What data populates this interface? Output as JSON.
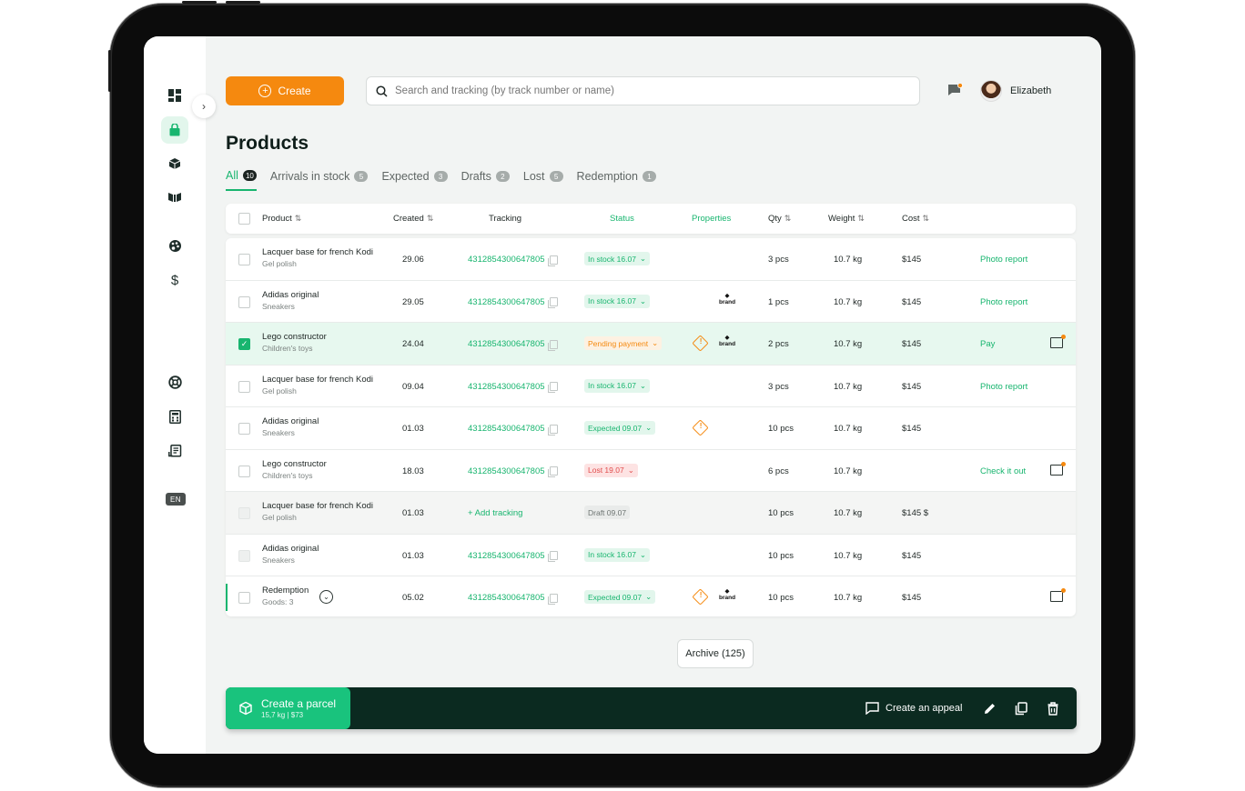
{
  "header": {
    "create_label": "Create",
    "search_placeholder": "Search and tracking (by track number or name)",
    "user_name": "Elizabeth"
  },
  "sidebar": {
    "items": [
      {
        "icon": "dashboard-icon"
      },
      {
        "icon": "shopping-bag-icon",
        "active": true
      },
      {
        "icon": "box-icon"
      },
      {
        "icon": "parcels-icon"
      },
      {
        "icon": "palette-icon"
      },
      {
        "icon": "dollar-icon"
      },
      {
        "icon": "support-icon"
      },
      {
        "icon": "calculator-icon"
      },
      {
        "icon": "documents-icon"
      }
    ],
    "language": "EN"
  },
  "page": {
    "title": "Products",
    "tabs": [
      {
        "label": "All",
        "count": "10",
        "active": true
      },
      {
        "label": "Arrivals in stock",
        "count": "5"
      },
      {
        "label": "Expected",
        "count": "3"
      },
      {
        "label": "Drafts",
        "count": "2"
      },
      {
        "label": "Lost",
        "count": "5"
      },
      {
        "label": "Redemption",
        "count": "1"
      }
    ]
  },
  "table": {
    "columns": {
      "product": "Product",
      "created": "Created",
      "tracking": "Tracking",
      "status": "Status",
      "properties": "Properties",
      "qty": "Qty",
      "weight": "Weight",
      "cost": "Cost"
    },
    "rows": [
      {
        "name": "Lacquer base for french Kodi",
        "sub": "Gel polish",
        "created": "29.06",
        "tracking": "4312854300647805",
        "status": "In stock 16.07",
        "qty": "3 pcs",
        "weight": "10.7 kg",
        "cost": "$145",
        "action": "Photo report"
      },
      {
        "name": "Adidas original",
        "sub": "Sneakers",
        "created": "29.05",
        "tracking": "4312854300647805",
        "status": "In stock 16.07",
        "brand": "brand",
        "qty": "1 pcs",
        "weight": "10.7 kg",
        "cost": "$145",
        "action": "Photo report"
      },
      {
        "name": "Lego constructor",
        "sub": "Children's toys",
        "created": "24.04",
        "tracking": "4312854300647805",
        "status": "Pending payment",
        "brand": "brand",
        "qty": "2 pcs",
        "weight": "10.7 kg",
        "cost": "$145",
        "action": "Pay"
      },
      {
        "name": "Lacquer base for french Kodi",
        "sub": "Gel polish",
        "created": "09.04",
        "tracking": "4312854300647805",
        "status": "In stock 16.07",
        "qty": "3 pcs",
        "weight": "10.7 kg",
        "cost": "$145",
        "action": "Photo report"
      },
      {
        "name": "Adidas original",
        "sub": "Sneakers",
        "created": "01.03",
        "tracking": "4312854300647805",
        "status": "Expected 09.07",
        "qty": "10 pcs",
        "weight": "10.7 kg",
        "cost": "$145",
        "action": ""
      },
      {
        "name": "Lego constructor",
        "sub": "Children's toys",
        "created": "18.03",
        "tracking": "4312854300647805",
        "status": "Lost 19.07",
        "qty": "6 pcs",
        "weight": "10.7 kg",
        "cost": "",
        "action": "Check it out"
      },
      {
        "name": "Lacquer base for french Kodi",
        "sub": "Gel polish",
        "created": "01.03",
        "tracking": "+ Add tracking",
        "status": "Draft 09.07",
        "qty": "10 pcs",
        "weight": "10.7 kg",
        "cost": "$145 $",
        "action": ""
      },
      {
        "name": "Adidas original",
        "sub": "Sneakers",
        "created": "01.03",
        "tracking": "4312854300647805",
        "status": "In stock 16.07",
        "qty": "10 pcs",
        "weight": "10.7 kg",
        "cost": "$145",
        "action": ""
      },
      {
        "name": "Redemption",
        "sub": "Goods: 3",
        "created": "05.02",
        "tracking": "4312854300647805",
        "status": "Expected 09.07",
        "brand": "brand",
        "qty": "10 pcs",
        "weight": "10.7 kg",
        "cost": "$145",
        "action": ""
      }
    ]
  },
  "archive_label": "Archive (125)",
  "bottom_bar": {
    "parcel_title": "Create a parcel",
    "parcel_meta": "15,7 kg  |  $73",
    "appeal_label": "Create an appeal"
  },
  "colors": {
    "accent_green": "#18b56f",
    "accent_orange": "#f5890f",
    "bar_dark": "#0b2a20",
    "lost_red": "#e14c4c"
  }
}
